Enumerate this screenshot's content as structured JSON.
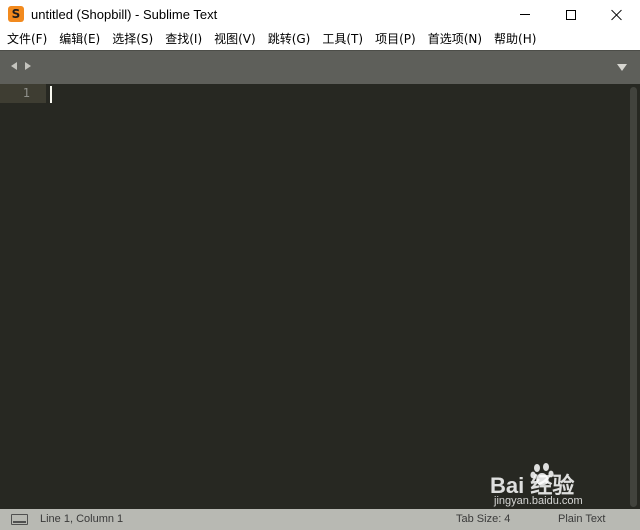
{
  "window": {
    "title": "untitled (Shopbill) - Sublime Text",
    "app_icon_letter": "S",
    "app_icon_color": "#f28a1e"
  },
  "menu": {
    "items": [
      {
        "label": "文件(F)"
      },
      {
        "label": "编辑(E)"
      },
      {
        "label": "选择(S)"
      },
      {
        "label": "查找(I)"
      },
      {
        "label": "视图(V)"
      },
      {
        "label": "跳转(G)"
      },
      {
        "label": "工具(T)"
      },
      {
        "label": "项目(P)"
      },
      {
        "label": "首选项(N)"
      },
      {
        "label": "帮助(H)"
      }
    ]
  },
  "editor": {
    "line_numbers": [
      "1"
    ],
    "background": "#272822",
    "tab_strip_color": "#5e5f5a"
  },
  "statusbar": {
    "position": "Line 1, Column 1",
    "tab_size": "Tab Size: 4",
    "syntax": "Plain Text"
  },
  "watermark": {
    "logo_text": "Bai  经验",
    "site": "jingyan.baidu.com"
  }
}
